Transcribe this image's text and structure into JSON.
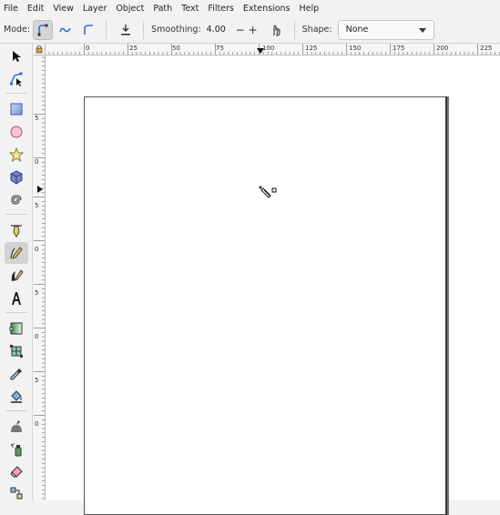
{
  "menu": [
    "File",
    "Edit",
    "View",
    "Layer",
    "Object",
    "Path",
    "Text",
    "Filters",
    "Extensions",
    "Help"
  ],
  "tool_controls": {
    "mode_label": "Mode:",
    "smoothing_label": "Smoothing:",
    "smoothing_value": "4.00",
    "minus": "−",
    "plus": "+",
    "shape_label": "Shape:",
    "shape_value": "None"
  },
  "ruler": {
    "h_labels": [
      "0",
      "25",
      "50",
      "75",
      "100",
      "125",
      "150",
      "175",
      "200",
      "225"
    ],
    "v_labels": [
      "5",
      "0",
      "5",
      "0",
      "5",
      "0",
      "5",
      "0"
    ]
  },
  "tools": [
    "selector-icon",
    "node-editor-icon",
    "rectangle-icon",
    "circle-icon",
    "star-icon",
    "3d-box-icon",
    "spiral-icon",
    "pen-bezier-icon",
    "pencil-icon",
    "calligraphy-icon",
    "text-icon",
    "gradient-icon",
    "mesh-icon",
    "dropper-icon",
    "paint-bucket-icon",
    "tweak-icon",
    "spray-icon",
    "eraser-icon",
    "connector-icon"
  ],
  "active_tool": "pencil-icon",
  "colors": {
    "accent": "#2f6fd6",
    "toolbar_bg": "#f2f2f2",
    "canvas_bg": "#ffffff"
  }
}
